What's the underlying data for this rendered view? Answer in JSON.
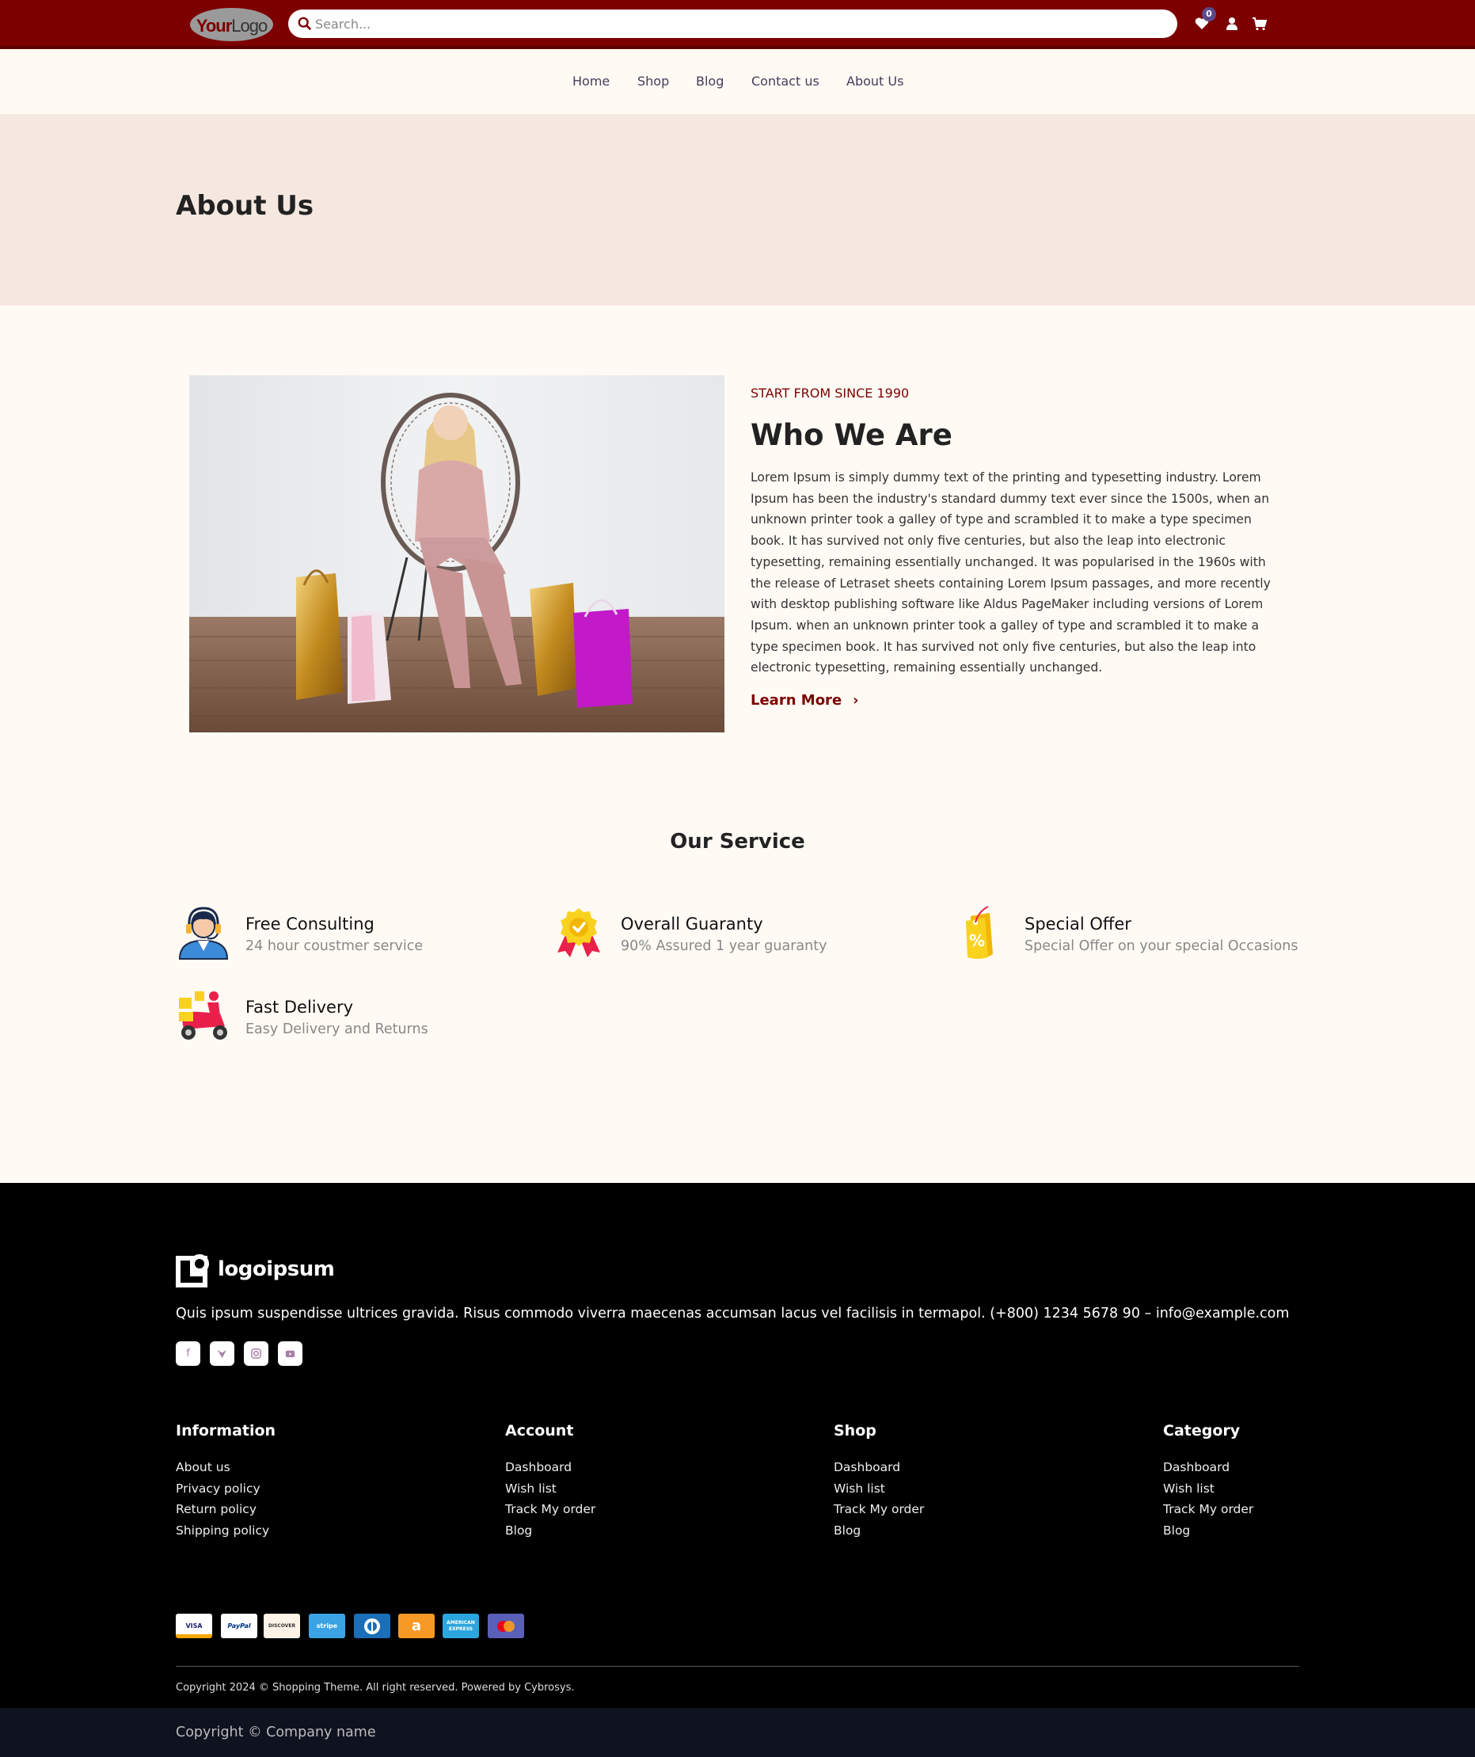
{
  "header": {
    "logo": "YourLogo",
    "search_placeholder": "Search...",
    "wishlist_count": "0"
  },
  "nav": [
    "Home",
    "Shop",
    "Blog",
    "Contact us",
    "About Us"
  ],
  "hero": {
    "title": "About Us"
  },
  "about": {
    "eyebrow": "START FROM SINCE 1990",
    "title": "Who We Are",
    "paragraph": "Lorem Ipsum is simply dummy text of the printing and typesetting industry. Lorem Ipsum has been the industry's standard dummy text ever since the 1500s, when an unknown printer took a galley of type and scrambled it to make a type specimen book. It has survived not only five centuries, but also the leap into electronic typesetting, remaining essentially unchanged. It was popularised in the 1960s with the release of Letraset sheets containing Lorem Ipsum passages, and more recently with desktop publishing software like Aldus PageMaker including versions of Lorem Ipsum. when an unknown printer took a galley of type and scrambled it to make a type specimen book. It has survived not only five centuries, but also the leap into electronic typesetting, remaining essentially unchanged.",
    "cta": "Learn More"
  },
  "services": {
    "title": "Our Service",
    "items": [
      {
        "title": "Free Consulting",
        "subtitle": "24 hour coustmer service",
        "icon": "support-agent-icon"
      },
      {
        "title": "Overall Guaranty",
        "subtitle": "90% Assured 1 year guaranty",
        "icon": "guarantee-badge-icon"
      },
      {
        "title": "Special Offer",
        "subtitle": "Special Offer on your special Occasions",
        "icon": "discount-tag-icon"
      },
      {
        "title": "Fast Delivery",
        "subtitle": "Easy Delivery and Returns",
        "icon": "delivery-scooter-icon"
      }
    ]
  },
  "footer": {
    "logo": "logoipsum",
    "description": "Quis ipsum suspendisse ultrices gravida. Risus commodo viverra maecenas accumsan lacus vel facilisis in termapol. (+800) 1234 5678 90 – info@example.com",
    "social": [
      "facebook-icon",
      "twitter-icon",
      "instagram-icon",
      "youtube-icon"
    ],
    "columns": [
      {
        "title": "Information",
        "links": [
          "About us",
          "Privacy policy",
          "Return policy",
          "Shipping policy"
        ]
      },
      {
        "title": "Account",
        "links": [
          "Dashboard",
          "Wish list",
          "Track My order",
          "Blog"
        ]
      },
      {
        "title": "Shop",
        "links": [
          "Dashboard",
          "Wish list",
          "Track My order",
          "Blog"
        ]
      },
      {
        "title": "Category",
        "links": [
          "Dashboard",
          "Wish list",
          "Track My order",
          "Blog"
        ]
      }
    ],
    "payments": [
      "VISA",
      "PayPal",
      "DISCOVER",
      "stripe",
      "Diners Club",
      "a",
      "AMERICAN EXPRESS",
      "mastercard"
    ],
    "copyright": "Copyright 2024 © Shopping Theme. All right reserved. Powered by Cybrosys.",
    "bottom_copyright": "Copyright © Company name"
  },
  "colors": {
    "brand": "#7d0000",
    "hero_bg": "#f5e8e1",
    "page_bg": "#fffaf4",
    "footer_bg": "#000000",
    "bottom_bar": "#0f1320"
  }
}
